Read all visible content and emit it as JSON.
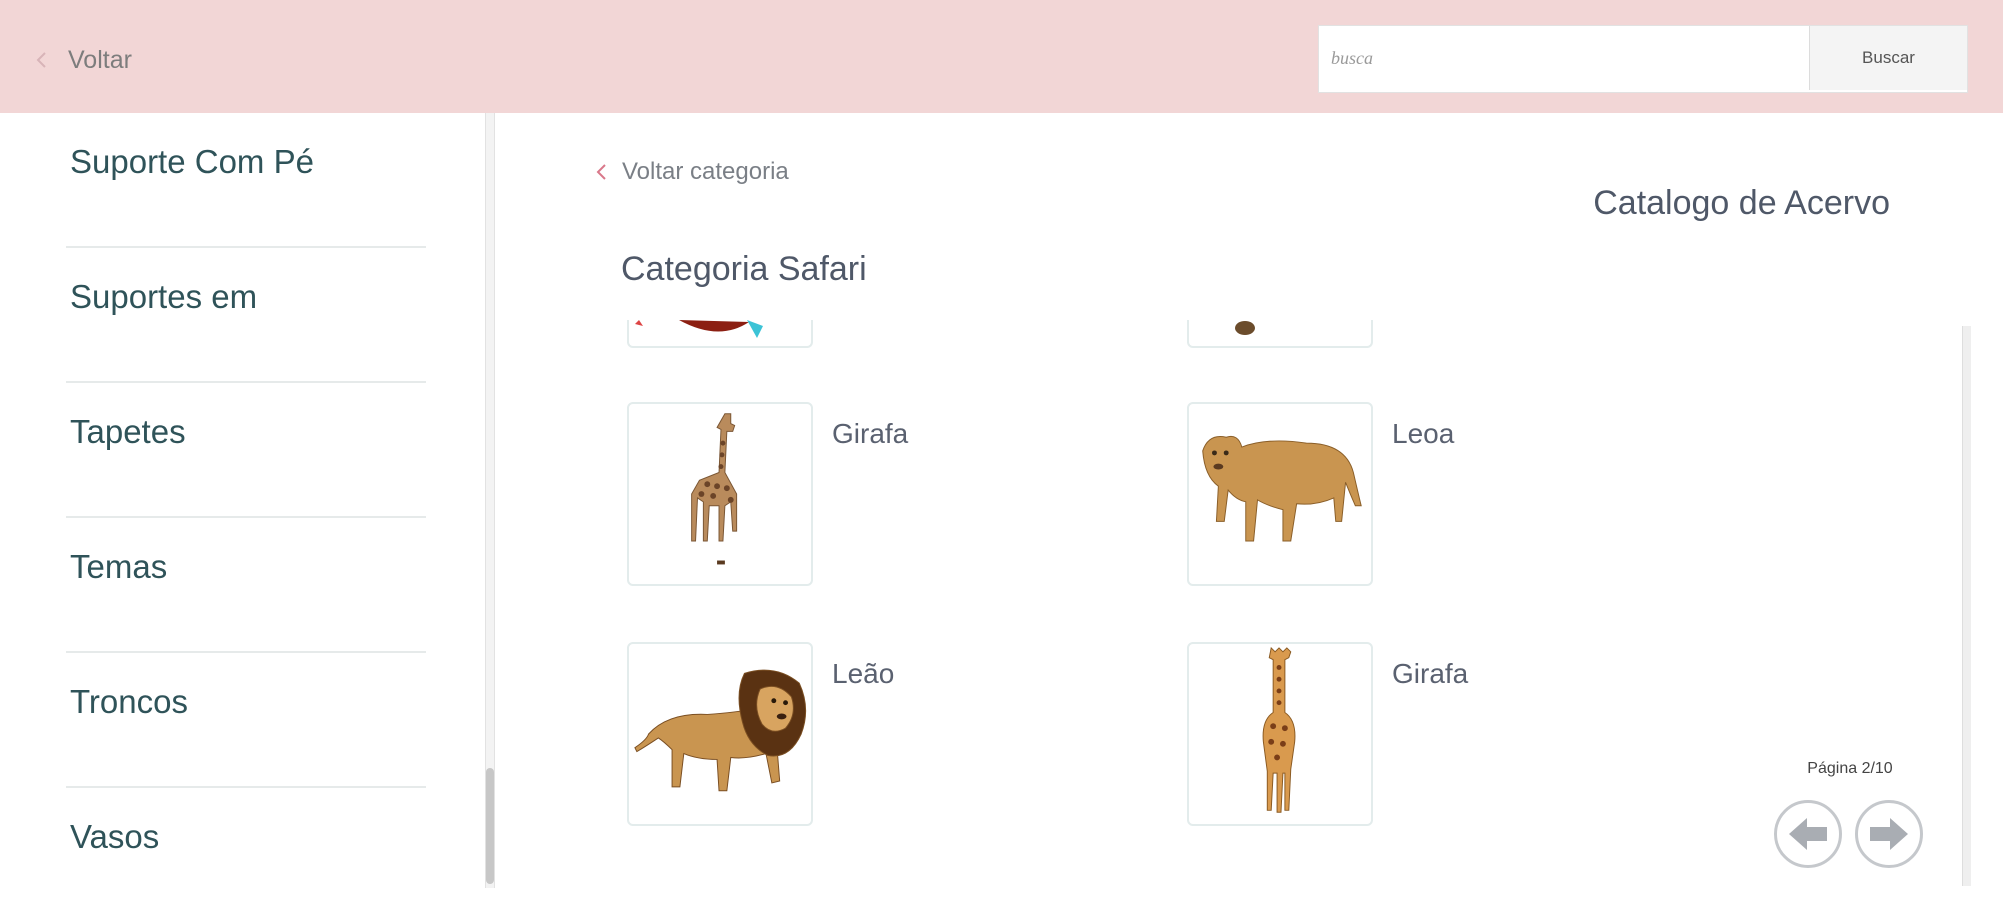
{
  "header": {
    "back_label": "Voltar",
    "search_placeholder": "busca",
    "search_button": "Buscar",
    "background_color": "#f2d6d6"
  },
  "sidebar": {
    "items": [
      {
        "label": "Suporte Com Pé"
      },
      {
        "label": "Suportes em"
      },
      {
        "label": "Tapetes"
      },
      {
        "label": "Temas"
      },
      {
        "label": "Troncos"
      },
      {
        "label": "Vasos"
      }
    ]
  },
  "main": {
    "back_category_label": "Voltar categoria",
    "catalog_title": "Catalogo de Acervo",
    "category_title": "Categoria Safari",
    "products": [
      {
        "name": "Girafa",
        "icon": "giraffe-image"
      },
      {
        "name": "Leoa",
        "icon": "lioness-image"
      },
      {
        "name": "Leão",
        "icon": "lion-image"
      },
      {
        "name": "Girafa",
        "icon": "giraffe-image"
      }
    ],
    "pagination": {
      "label": "Página 2/10",
      "prev_icon": "arrow-left-icon",
      "next_icon": "arrow-right-icon"
    }
  },
  "colors": {
    "accent_chevron": "#d9788a",
    "sidebar_text": "#2f5359",
    "title_text": "#4f5868"
  }
}
